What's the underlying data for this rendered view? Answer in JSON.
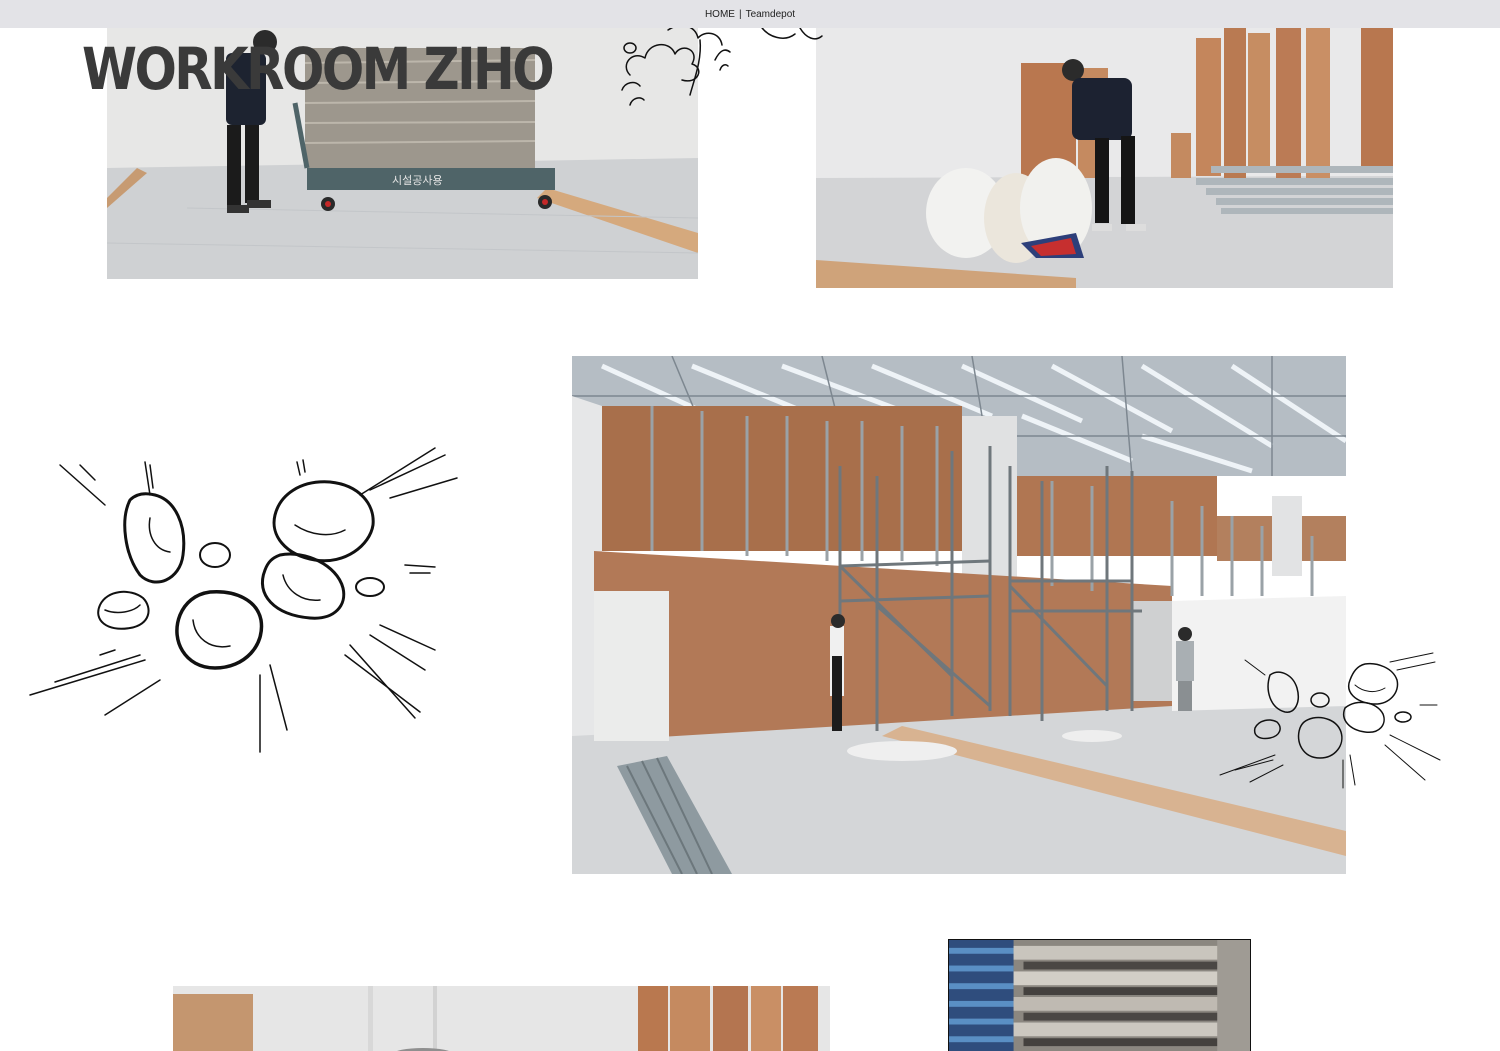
{
  "nav": {
    "home_label": "HOME",
    "separator": "|",
    "site_label": "Teamdepot"
  },
  "logo": {
    "text": "WORKROOM ZIHO"
  },
  "photos": [
    {
      "name": "photo-cart-cardboard",
      "icon": "photo-icon"
    },
    {
      "name": "photo-bags-lumber",
      "icon": "photo-icon"
    },
    {
      "name": "photo-scaffolding-wall",
      "icon": "photo-icon"
    },
    {
      "name": "photo-plywood-room",
      "icon": "photo-icon"
    },
    {
      "name": "photo-stacked-boards",
      "icon": "photo-icon"
    }
  ],
  "photo_1": {
    "cart_text": "시설공사용"
  },
  "colors": {
    "topbar_bg": "#e3e3e7",
    "logo_text": "#3a3a3a",
    "plywood": "#b07a55",
    "floor": "#d6d8da"
  }
}
